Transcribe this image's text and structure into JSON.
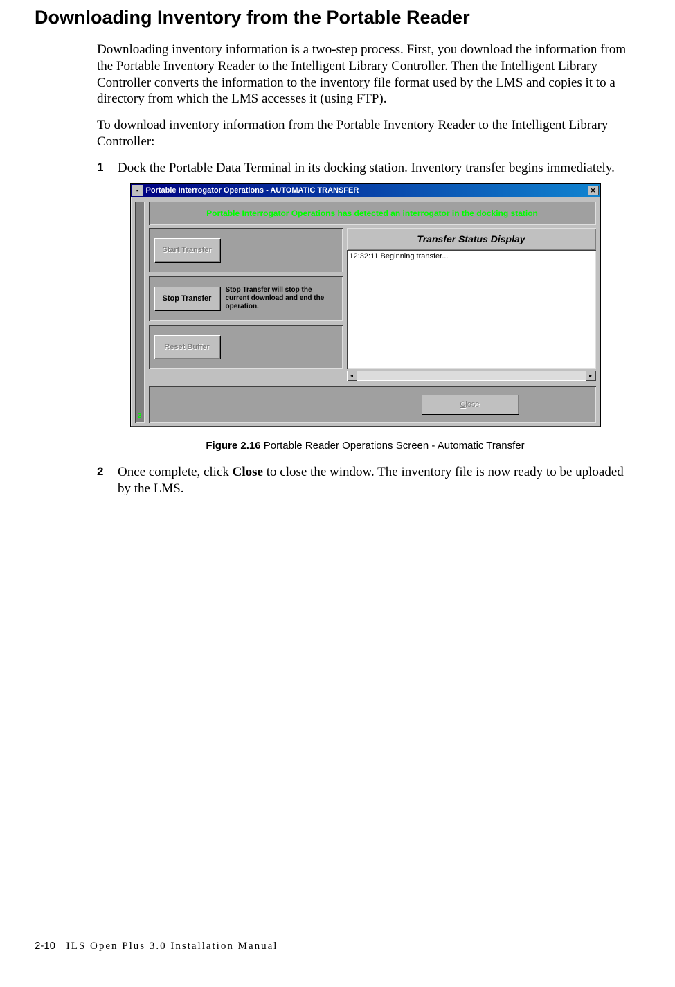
{
  "heading": "Downloading Inventory from the Portable Reader",
  "para1": "Downloading inventory information is a two-step process. First, you download the information from the Portable Inventory Reader to the Intelligent Library Controller. Then the Intelligent Library Controller converts the information to the inventory file format used by the LMS and copies it to a directory from which the LMS accesses it (using FTP).",
  "para2": "To download inventory information from the Portable Inventory Reader to the Intelligent Library Controller:",
  "steps": [
    {
      "num": "1",
      "text": "Dock the Portable Data Terminal in its docking station. Inventory transfer begins immediately."
    },
    {
      "num": "2",
      "before": "Once complete, click ",
      "bold": "Close",
      "after": " to close the window. The inventory file is now ready to be uploaded by the LMS."
    }
  ],
  "window": {
    "title": "Portable Interrogator Operations  -  AUTOMATIC TRANSFER",
    "banner": "Portable Interrogator Operations has detected an interrogator in the docking station",
    "sidebar_char": "2",
    "buttons": {
      "start": "Start Transfer",
      "stop": "Stop Transfer",
      "stop_desc": "Stop Transfer will stop the current download and end the operation.",
      "reset": "Reset Buffer",
      "close": "Close"
    },
    "status": {
      "header": "Transfer Status Display",
      "log": "12:32:11 Beginning transfer..."
    }
  },
  "figure": {
    "label": "Figure 2.16",
    "caption": " Portable Reader Operations Screen - Automatic Transfer"
  },
  "footer": {
    "pagenum": "2-10",
    "title": "ILS Open Plus 3.0 Installation Manual"
  }
}
